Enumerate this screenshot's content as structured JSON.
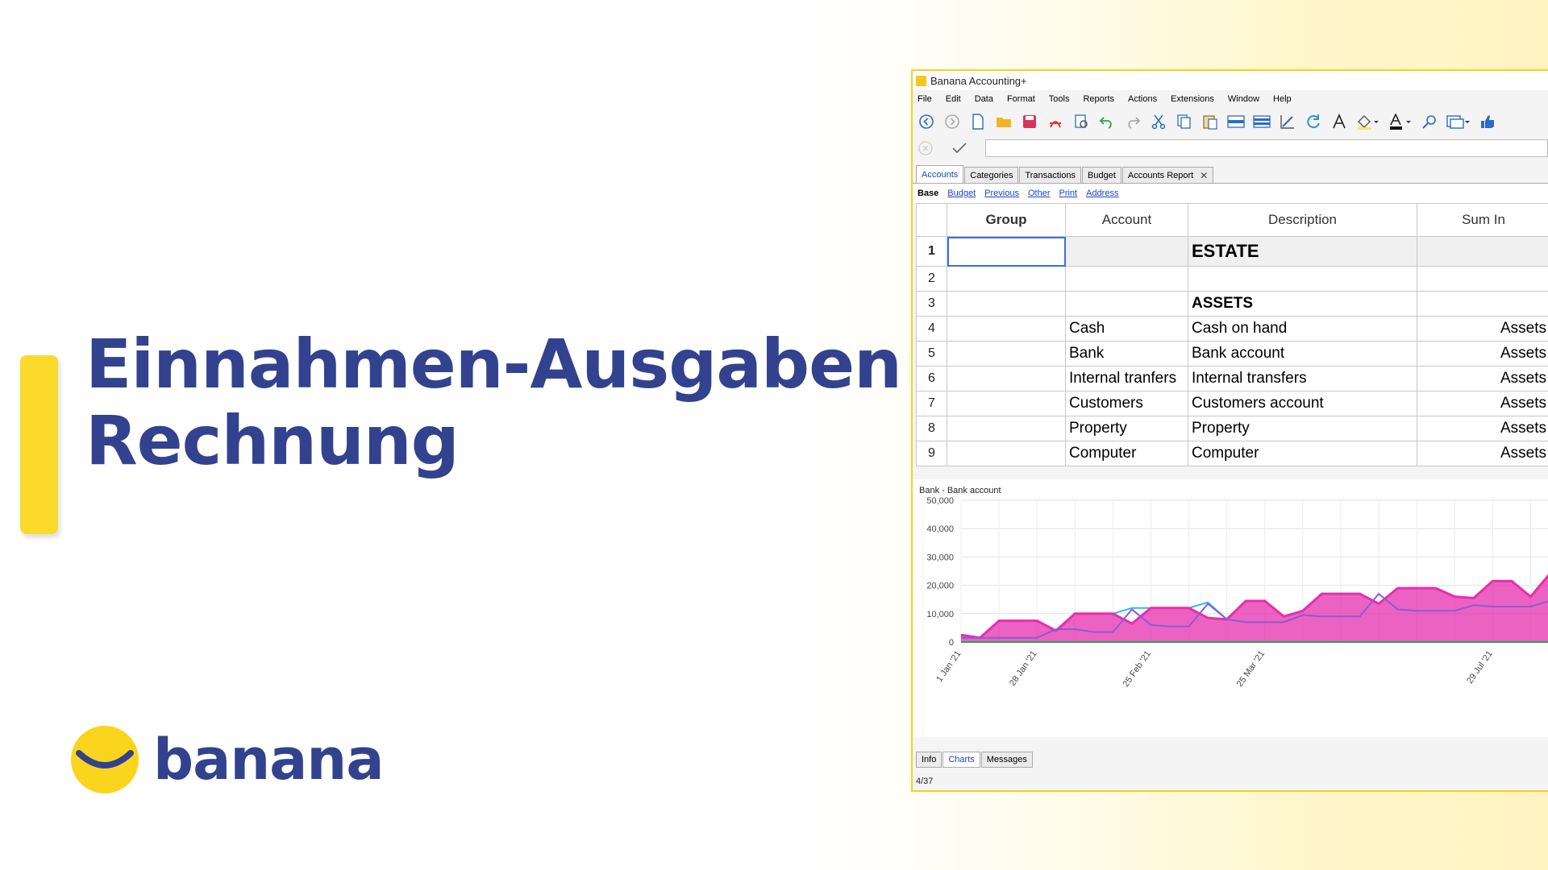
{
  "hero": {
    "title_line1": "Einnahmen-Ausgaben",
    "title_line2": "Rechnung"
  },
  "logo": {
    "wordmark": "banana"
  },
  "app": {
    "window_title": "Banana Accounting+",
    "menu": [
      "File",
      "Edit",
      "Data",
      "Format",
      "Tools",
      "Reports",
      "Actions",
      "Extensions",
      "Window",
      "Help"
    ],
    "toolbar_icons": [
      "back-arrow-icon",
      "forward-arrow-icon",
      "new-file-icon",
      "open-folder-icon",
      "save-icon",
      "pdf-icon",
      "print-preview-icon",
      "undo-icon",
      "redo-icon",
      "cut-icon",
      "copy-icon",
      "paste-icon",
      "insert-row-icon",
      "insert-rows-icon",
      "column-setup-icon",
      "refresh-icon",
      "font-icon",
      "fill-color-icon",
      "text-color-icon",
      "search-icon",
      "window-icon",
      "thumbs-up-icon"
    ],
    "tabs": [
      "Accounts",
      "Categories",
      "Transactions",
      "Budget",
      "Accounts Report"
    ],
    "active_tab": "Accounts",
    "subtabs": [
      "Base",
      "Budget",
      "Previous",
      "Other",
      "Print",
      "Address"
    ],
    "table": {
      "columns": [
        "Group",
        "Account",
        "Description",
        "Sum In"
      ],
      "rows": [
        {
          "n": "1",
          "group": "",
          "account": "",
          "description": "ESTATE",
          "sumin": ""
        },
        {
          "n": "2",
          "group": "",
          "account": "",
          "description": "",
          "sumin": ""
        },
        {
          "n": "3",
          "group": "",
          "account": "",
          "description": "ASSETS",
          "sumin": ""
        },
        {
          "n": "4",
          "group": "",
          "account": "Cash",
          "description": "Cash on hand",
          "sumin": "Assets"
        },
        {
          "n": "5",
          "group": "",
          "account": "Bank",
          "description": "Bank account",
          "sumin": "Assets"
        },
        {
          "n": "6",
          "group": "",
          "account": "Internal tranfers",
          "description": "Internal transfers",
          "sumin": "Assets"
        },
        {
          "n": "7",
          "group": "",
          "account": "Customers",
          "description": "Customers account",
          "sumin": "Assets"
        },
        {
          "n": "8",
          "group": "",
          "account": "Property",
          "description": "Property",
          "sumin": "Assets"
        },
        {
          "n": "9",
          "group": "",
          "account": "Computer",
          "description": "Computer",
          "sumin": "Assets"
        }
      ]
    },
    "bottom_tabs": [
      "Info",
      "Charts",
      "Messages"
    ],
    "active_bottom_tab": "Charts",
    "status": "4/37"
  },
  "chart_data": {
    "type": "area",
    "title": "Bank - Bank account",
    "ylim": [
      0,
      50000
    ],
    "yticks": [
      "50,000",
      "40,000",
      "30,000",
      "20,000",
      "10,000",
      "0"
    ],
    "xtick_labels": [
      "1 Jan '21",
      "28 Jan '21",
      "25 Feb '21",
      "25 Mar '21",
      "29 Jul '21"
    ],
    "grid": true,
    "series": [
      {
        "color": "#e62eae",
        "values": [
          2500,
          1500,
          7500,
          7500,
          7500,
          4000,
          10000,
          10000,
          10000,
          6500,
          12000,
          12000,
          12000,
          8500,
          8000,
          14500,
          14500,
          9000,
          11000,
          17000,
          17000,
          17000,
          13500,
          19000,
          19000,
          19000,
          16000,
          15500,
          21500,
          21500,
          16000,
          24000
        ]
      },
      {
        "color": "#8a5bd4",
        "values": [
          1500,
          1500,
          1500,
          1500,
          1500,
          4500,
          4500,
          3500,
          3500,
          11500,
          6000,
          5500,
          5500,
          13500,
          8000,
          7000,
          7000,
          7000,
          9500,
          9000,
          9000,
          9000,
          17000,
          11500,
          11000,
          11000,
          11000,
          13000,
          12500,
          12500,
          12500,
          14500,
          14500
        ]
      },
      {
        "color": "#39b4ea",
        "values": [
          0,
          0,
          0,
          0,
          0,
          0,
          0,
          0,
          0,
          12000,
          0,
          0,
          0,
          14000,
          0,
          0,
          0,
          0,
          0,
          0,
          0,
          0,
          0,
          0,
          0,
          0,
          0,
          0,
          0,
          0,
          0,
          0
        ]
      }
    ]
  }
}
